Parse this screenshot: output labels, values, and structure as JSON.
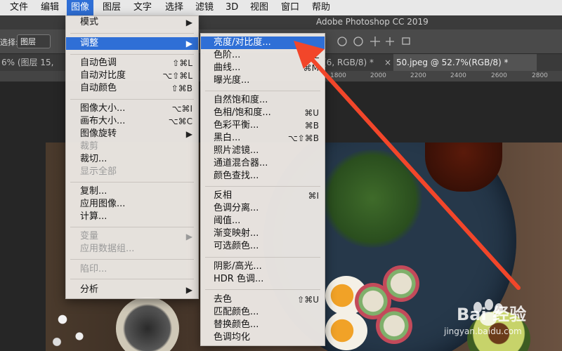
{
  "menubar": {
    "items": [
      "文件",
      "编辑",
      "图像",
      "图层",
      "文字",
      "选择",
      "滤镜",
      "3D",
      "视图",
      "窗口",
      "帮助"
    ],
    "active_index": 2
  },
  "app_title": "Adobe Photoshop CC 2019",
  "options_bar": {
    "select_label": "选择:",
    "layer_value": "图层"
  },
  "tabs": [
    {
      "label": "6% (图层 15, RGB/...",
      "active": false
    },
    {
      "label": "(6, RGB/8) *",
      "active": false
    },
    {
      "label": "50.jpeg @ 52.7%(RGB/8) *",
      "active": true
    }
  ],
  "tab_close": "×",
  "ruler": {
    "ticks": [
      "1800",
      "2000",
      "2200",
      "2400",
      "2600",
      "2800"
    ]
  },
  "image_menu": {
    "items": [
      {
        "label": "模式",
        "shortcut": "",
        "submenu": true,
        "disabled": false
      },
      {
        "label": "调整",
        "shortcut": "",
        "submenu": true,
        "disabled": false,
        "highlighted": true
      },
      {
        "label": "自动色调",
        "shortcut": "⇧⌘L"
      },
      {
        "label": "自动对比度",
        "shortcut": "⌥⇧⌘L"
      },
      {
        "label": "自动颜色",
        "shortcut": "⇧⌘B"
      },
      {
        "label": "图像大小...",
        "shortcut": "⌥⌘I"
      },
      {
        "label": "画布大小...",
        "shortcut": "⌥⌘C"
      },
      {
        "label": "图像旋转",
        "shortcut": "",
        "submenu": true
      },
      {
        "label": "裁剪",
        "shortcut": "",
        "disabled": true
      },
      {
        "label": "裁切...",
        "shortcut": ""
      },
      {
        "label": "显示全部",
        "shortcut": "",
        "disabled": true
      },
      {
        "label": "复制...",
        "shortcut": ""
      },
      {
        "label": "应用图像...",
        "shortcut": ""
      },
      {
        "label": "计算...",
        "shortcut": ""
      },
      {
        "label": "变量",
        "shortcut": "",
        "submenu": true,
        "disabled": true
      },
      {
        "label": "应用数据组...",
        "shortcut": "",
        "disabled": true
      },
      {
        "label": "陷印...",
        "shortcut": "",
        "disabled": true
      },
      {
        "label": "分析",
        "shortcut": "",
        "submenu": true
      }
    ]
  },
  "adjust_menu": {
    "items": [
      {
        "label": "亮度/对比度...",
        "shortcut": "",
        "highlighted": true
      },
      {
        "label": "色阶...",
        "shortcut": "⌘L"
      },
      {
        "label": "曲线...",
        "shortcut": "⌘M"
      },
      {
        "label": "曝光度...",
        "shortcut": ""
      },
      {
        "label": "自然饱和度...",
        "shortcut": ""
      },
      {
        "label": "色相/饱和度...",
        "shortcut": "⌘U"
      },
      {
        "label": "色彩平衡...",
        "shortcut": "⌘B"
      },
      {
        "label": "黑白...",
        "shortcut": "⌥⇧⌘B"
      },
      {
        "label": "照片滤镜...",
        "shortcut": ""
      },
      {
        "label": "通道混合器...",
        "shortcut": ""
      },
      {
        "label": "颜色查找...",
        "shortcut": ""
      },
      {
        "label": "反相",
        "shortcut": "⌘I"
      },
      {
        "label": "色调分离...",
        "shortcut": ""
      },
      {
        "label": "阈值...",
        "shortcut": ""
      },
      {
        "label": "渐变映射...",
        "shortcut": ""
      },
      {
        "label": "可选颜色...",
        "shortcut": ""
      },
      {
        "label": "阴影/高光...",
        "shortcut": ""
      },
      {
        "label": "HDR 色调...",
        "shortcut": ""
      },
      {
        "label": "去色",
        "shortcut": "⇧⌘U"
      },
      {
        "label": "匹配颜色...",
        "shortcut": ""
      },
      {
        "label": "替换颜色...",
        "shortcut": ""
      },
      {
        "label": "色调均化",
        "shortcut": ""
      }
    ]
  },
  "submenu_arrow": "▶",
  "watermark": {
    "brand": "Bai 经验",
    "url": "jingyan.baidu.com"
  },
  "colors": {
    "highlight": "#2f6fd6",
    "annotation_arrow": "#f2462a"
  }
}
